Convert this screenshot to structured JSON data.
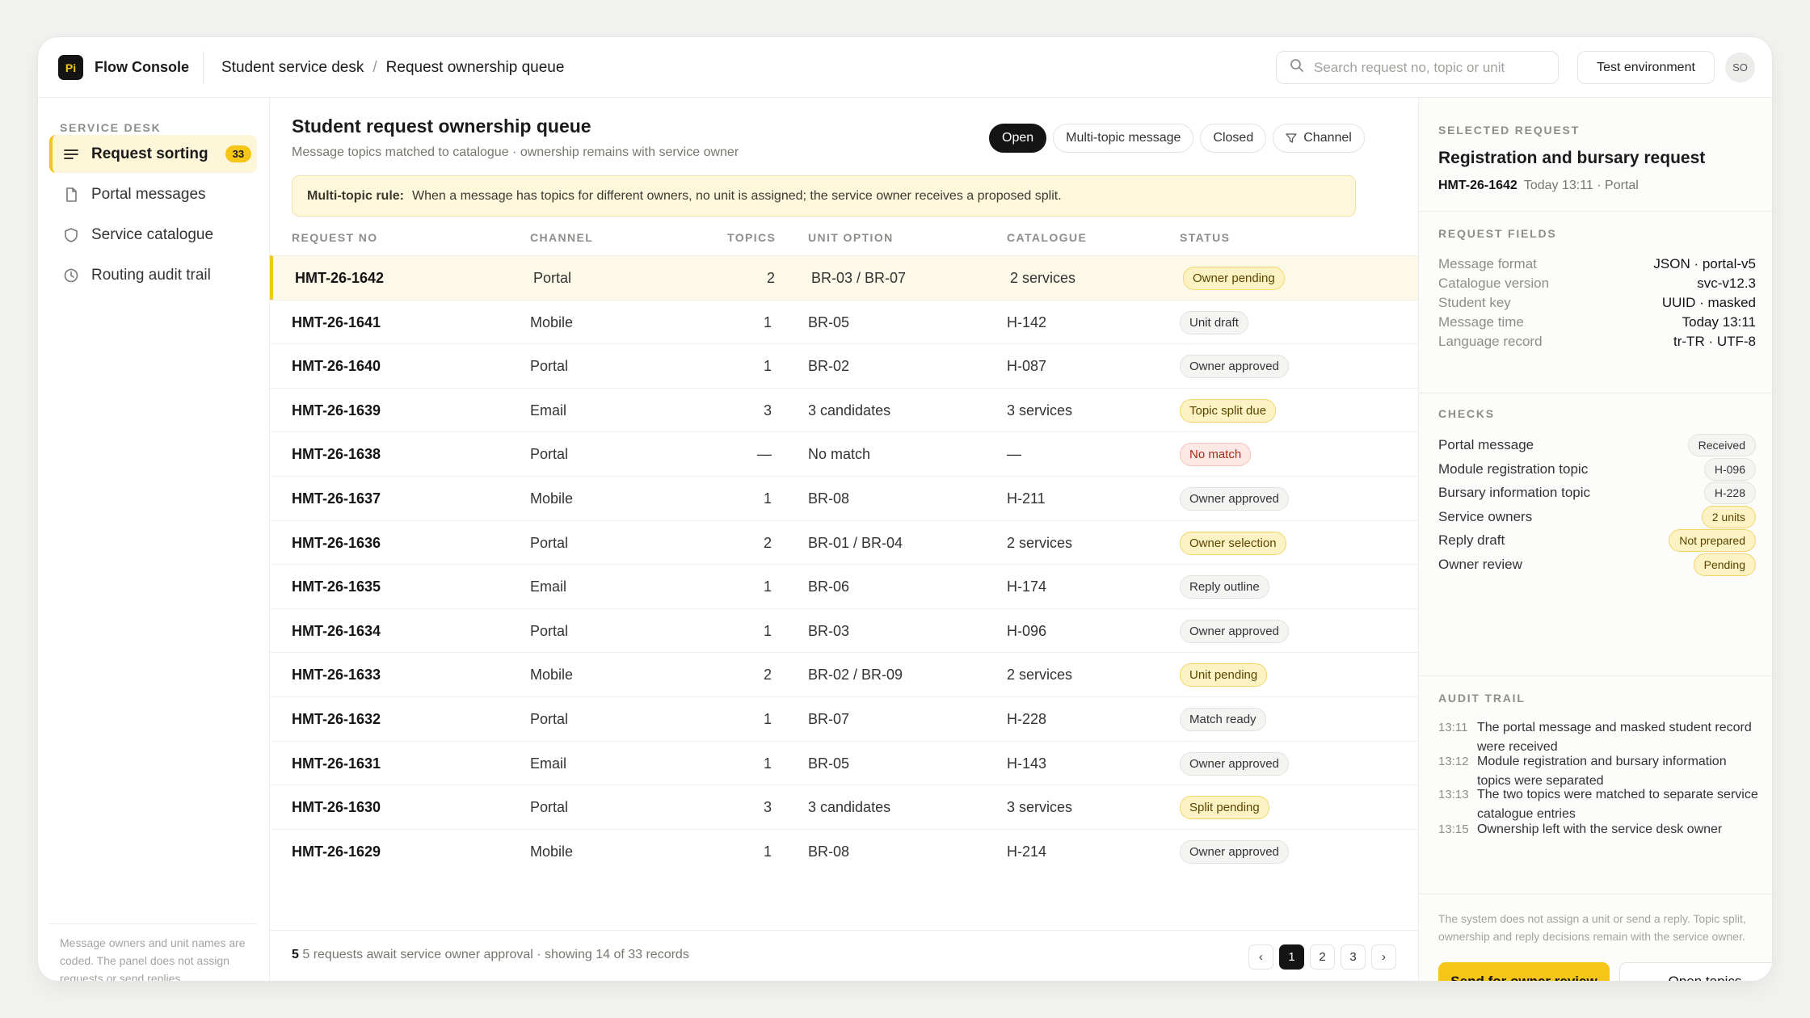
{
  "app": {
    "logo_text": "Pi",
    "name": "Flow Console"
  },
  "breadcrumb": [
    "Student service desk",
    "Request ownership queue"
  ],
  "search": {
    "placeholder": "Search request no, topic or unit",
    "value": ""
  },
  "env_label": "Test environment",
  "avatar_initials": "SO",
  "sidebar": {
    "heading": "SERVICE DESK",
    "items": [
      {
        "label": "Request sorting",
        "badge": "33",
        "icon": "list-icon"
      },
      {
        "label": "Portal messages",
        "icon": "document-icon"
      },
      {
        "label": "Service catalogue",
        "icon": "shield-icon"
      },
      {
        "label": "Routing audit trail",
        "icon": "clock-icon"
      }
    ],
    "note": "Message owners and unit names are coded. The panel does not assign requests or send replies."
  },
  "queue": {
    "title": "Student request ownership queue",
    "subtitle": "Message topics matched to catalogue · ownership remains with service owner",
    "filters": [
      "Open",
      "Multi-topic message",
      "Closed",
      "Channel"
    ],
    "rule_label": "Multi-topic rule:",
    "rule_text": "When a message has topics for different owners, no unit is assigned; the service owner receives a proposed split.",
    "columns": [
      "REQUEST NO",
      "CHANNEL",
      "TOPICS",
      "UNIT OPTION",
      "CATALOGUE",
      "STATUS"
    ],
    "rows": [
      {
        "no": "HMT-26-1642",
        "channel": "Portal",
        "topics": "2",
        "unit": "BR-03 / BR-07",
        "catalogue": "2 services",
        "status": "Owner pending"
      },
      {
        "no": "HMT-26-1641",
        "channel": "Mobile",
        "topics": "1",
        "unit": "BR-05",
        "catalogue": "H-142",
        "status": "Unit draft"
      },
      {
        "no": "HMT-26-1640",
        "channel": "Portal",
        "topics": "1",
        "unit": "BR-02",
        "catalogue": "H-087",
        "status": "Owner approved"
      },
      {
        "no": "HMT-26-1639",
        "channel": "Email",
        "topics": "3",
        "unit": "3 candidates",
        "catalogue": "3 services",
        "status": "Topic split due"
      },
      {
        "no": "HMT-26-1638",
        "channel": "Portal",
        "topics": "—",
        "unit": "No match",
        "catalogue": "—",
        "status": "No match"
      },
      {
        "no": "HMT-26-1637",
        "channel": "Mobile",
        "topics": "1",
        "unit": "BR-08",
        "catalogue": "H-211",
        "status": "Owner approved"
      },
      {
        "no": "HMT-26-1636",
        "channel": "Portal",
        "topics": "2",
        "unit": "BR-01 / BR-04",
        "catalogue": "2 services",
        "status": "Owner selection"
      },
      {
        "no": "HMT-26-1635",
        "channel": "Email",
        "topics": "1",
        "unit": "BR-06",
        "catalogue": "H-174",
        "status": "Reply outline"
      },
      {
        "no": "HMT-26-1634",
        "channel": "Portal",
        "topics": "1",
        "unit": "BR-03",
        "catalogue": "H-096",
        "status": "Owner approved"
      },
      {
        "no": "HMT-26-1633",
        "channel": "Mobile",
        "topics": "2",
        "unit": "BR-02 / BR-09",
        "catalogue": "2 services",
        "status": "Unit pending"
      },
      {
        "no": "HMT-26-1632",
        "channel": "Portal",
        "topics": "1",
        "unit": "BR-07",
        "catalogue": "H-228",
        "status": "Match ready"
      },
      {
        "no": "HMT-26-1631",
        "channel": "Email",
        "topics": "1",
        "unit": "BR-05",
        "catalogue": "H-143",
        "status": "Owner approved"
      },
      {
        "no": "HMT-26-1630",
        "channel": "Portal",
        "topics": "3",
        "unit": "3 candidates",
        "catalogue": "3 services",
        "status": "Split pending"
      },
      {
        "no": "HMT-26-1629",
        "channel": "Mobile",
        "topics": "1",
        "unit": "BR-08",
        "catalogue": "H-214",
        "status": "Owner approved"
      }
    ],
    "footer_count": "5",
    "footer_text": "5 requests await service owner approval · showing 14 of 33 records",
    "pages": [
      "1",
      "2",
      "3"
    ],
    "prev_label": "‹",
    "next_label": "›"
  },
  "detail": {
    "section_label": "SELECTED REQUEST",
    "title": "Registration and bursary request",
    "request_no": "HMT-26-1642",
    "meta": "Today 13:11 · Portal",
    "fields_label": "REQUEST FIELDS",
    "fields": [
      {
        "key": "Message format",
        "value": "JSON · portal-v5"
      },
      {
        "key": "Catalogue version",
        "value": "svc-v12.3"
      },
      {
        "key": "Student key",
        "value": "UUID · masked"
      },
      {
        "key": "Message time",
        "value": "Today 13:11"
      },
      {
        "key": "Language record",
        "value": "tr-TR · UTF-8"
      }
    ],
    "checks_label": "CHECKS",
    "checks": [
      {
        "label": "Portal message",
        "value": "Received"
      },
      {
        "label": "Module registration topic",
        "value": "H-096"
      },
      {
        "label": "Bursary information topic",
        "value": "H-228"
      },
      {
        "label": "Service owners",
        "value": "2 units"
      },
      {
        "label": "Reply draft",
        "value": "Not prepared"
      },
      {
        "label": "Owner review",
        "value": "Pending"
      }
    ],
    "audit_label": "AUDIT TRAIL",
    "audit": [
      {
        "time": "13:11",
        "text": "The portal message and masked student record were received"
      },
      {
        "time": "13:12",
        "text": "Module registration and bursary information topics were separated"
      },
      {
        "time": "13:13",
        "text": "The two topics were matched to separate service catalogue entries"
      },
      {
        "time": "13:15",
        "text": "Ownership left with the service desk owner"
      }
    ],
    "note": "The system does not assign a unit or send a reply. Topic split, ownership and reply decisions remain with the service owner.",
    "primary_button": "Send for owner review",
    "secondary_button": "Open topics"
  },
  "colors": {
    "accent": "#f5c518",
    "dark": "#141414",
    "warn_bg": "#fdf2c4",
    "danger_text": "#b0281c"
  }
}
